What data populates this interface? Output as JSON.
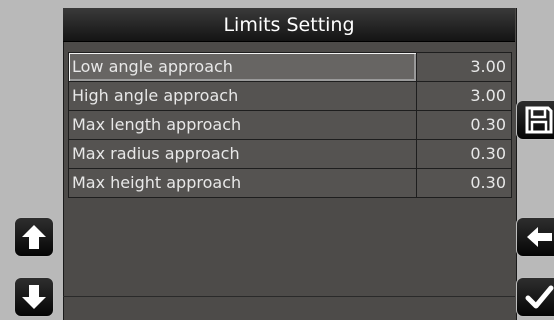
{
  "window": {
    "title": "Limits Setting"
  },
  "limits": [
    {
      "label": "Low angle approach",
      "value": "3.00",
      "selected": true
    },
    {
      "label": "High angle approach",
      "value": "3.00"
    },
    {
      "label": "Max length approach",
      "value": "0.30"
    },
    {
      "label": "Max radius approach",
      "value": "0.30"
    },
    {
      "label": "Max height approach",
      "value": "0.30"
    }
  ],
  "icons": {
    "up": "arrow-up-icon",
    "down": "arrow-down-icon",
    "save": "floppy-disk-icon",
    "back": "arrow-left-icon",
    "ok": "checkmark-icon"
  },
  "colors": {
    "panel": "#4d4b49",
    "row": "#555351",
    "selected_row": "#676563",
    "text": "#e8e8e8",
    "background": "#b9b9b9"
  }
}
